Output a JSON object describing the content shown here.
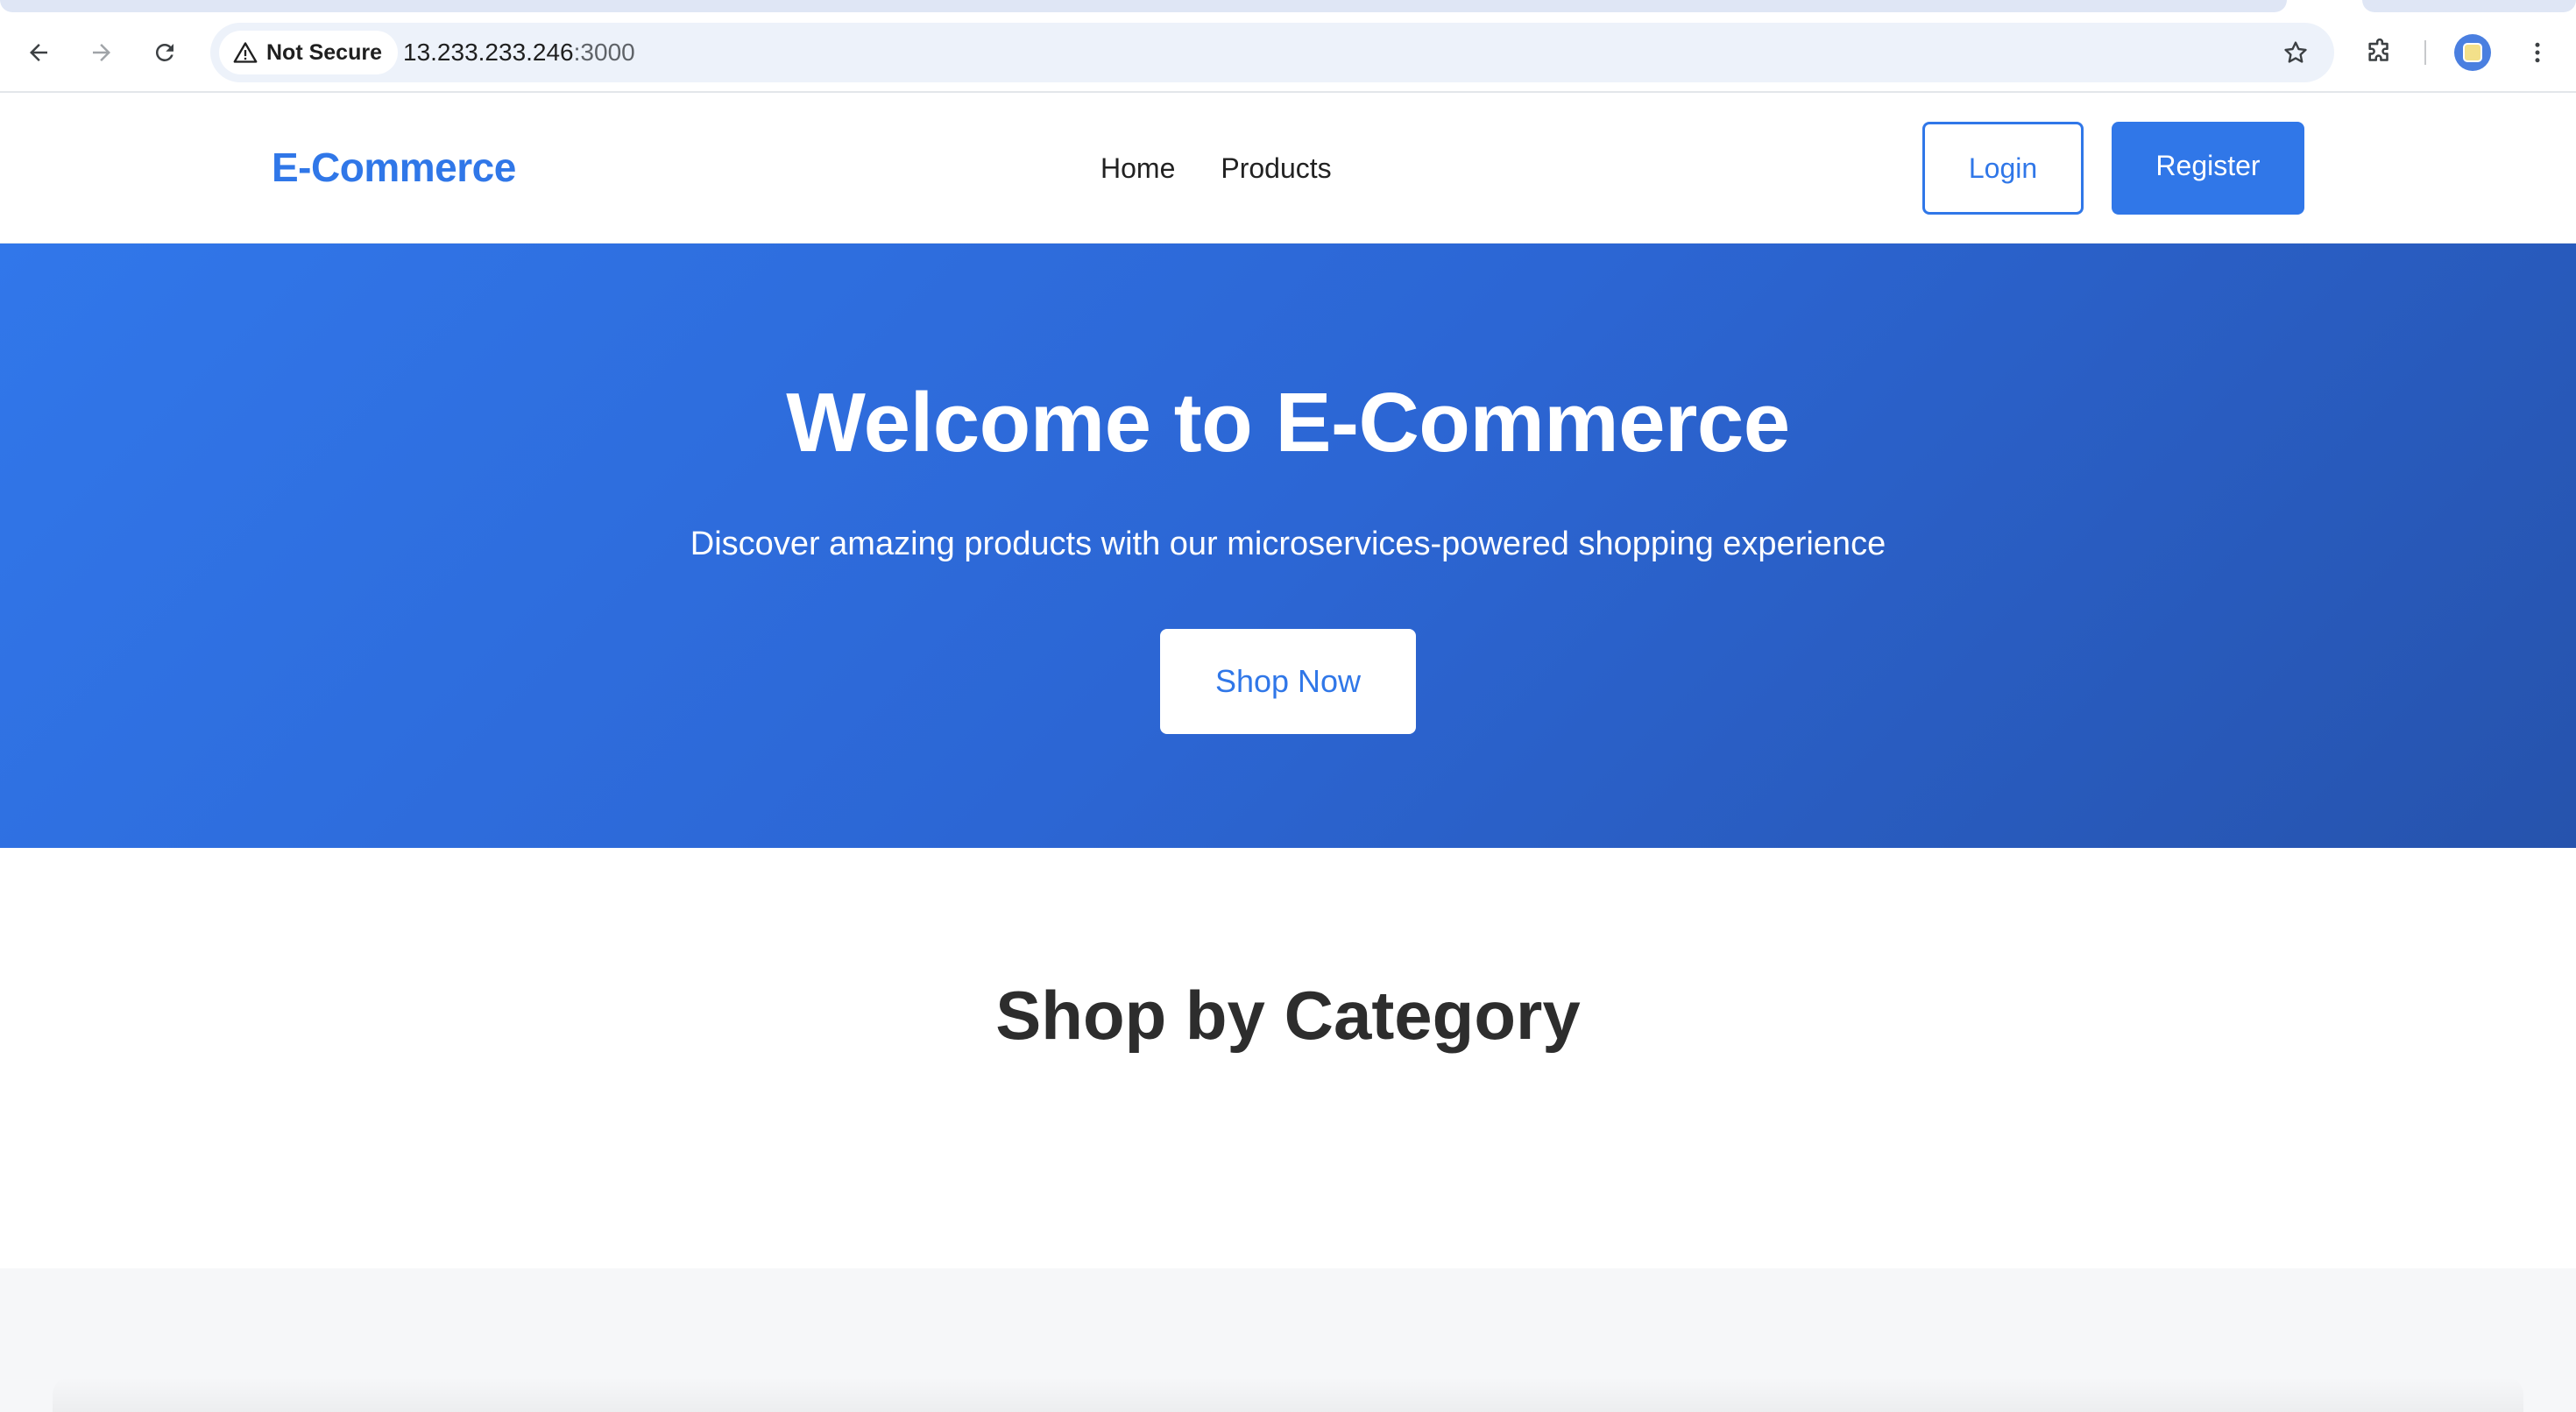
{
  "browser": {
    "security_label": "Not Secure",
    "url_host": "13.233.233.246",
    "url_port": ":3000"
  },
  "header": {
    "brand": "E-Commerce",
    "nav": [
      "Home",
      "Products"
    ],
    "login_label": "Login",
    "register_label": "Register"
  },
  "hero": {
    "title": "Welcome to E-Commerce",
    "subtitle": "Discover amazing products with our microservices-powered shopping experience",
    "cta_label": "Shop Now"
  },
  "categories": {
    "title": "Shop by Category"
  },
  "colors": {
    "brand_blue": "#3077e8",
    "hero_gradient_start": "#3177ea",
    "hero_gradient_end": "#2653ad"
  }
}
